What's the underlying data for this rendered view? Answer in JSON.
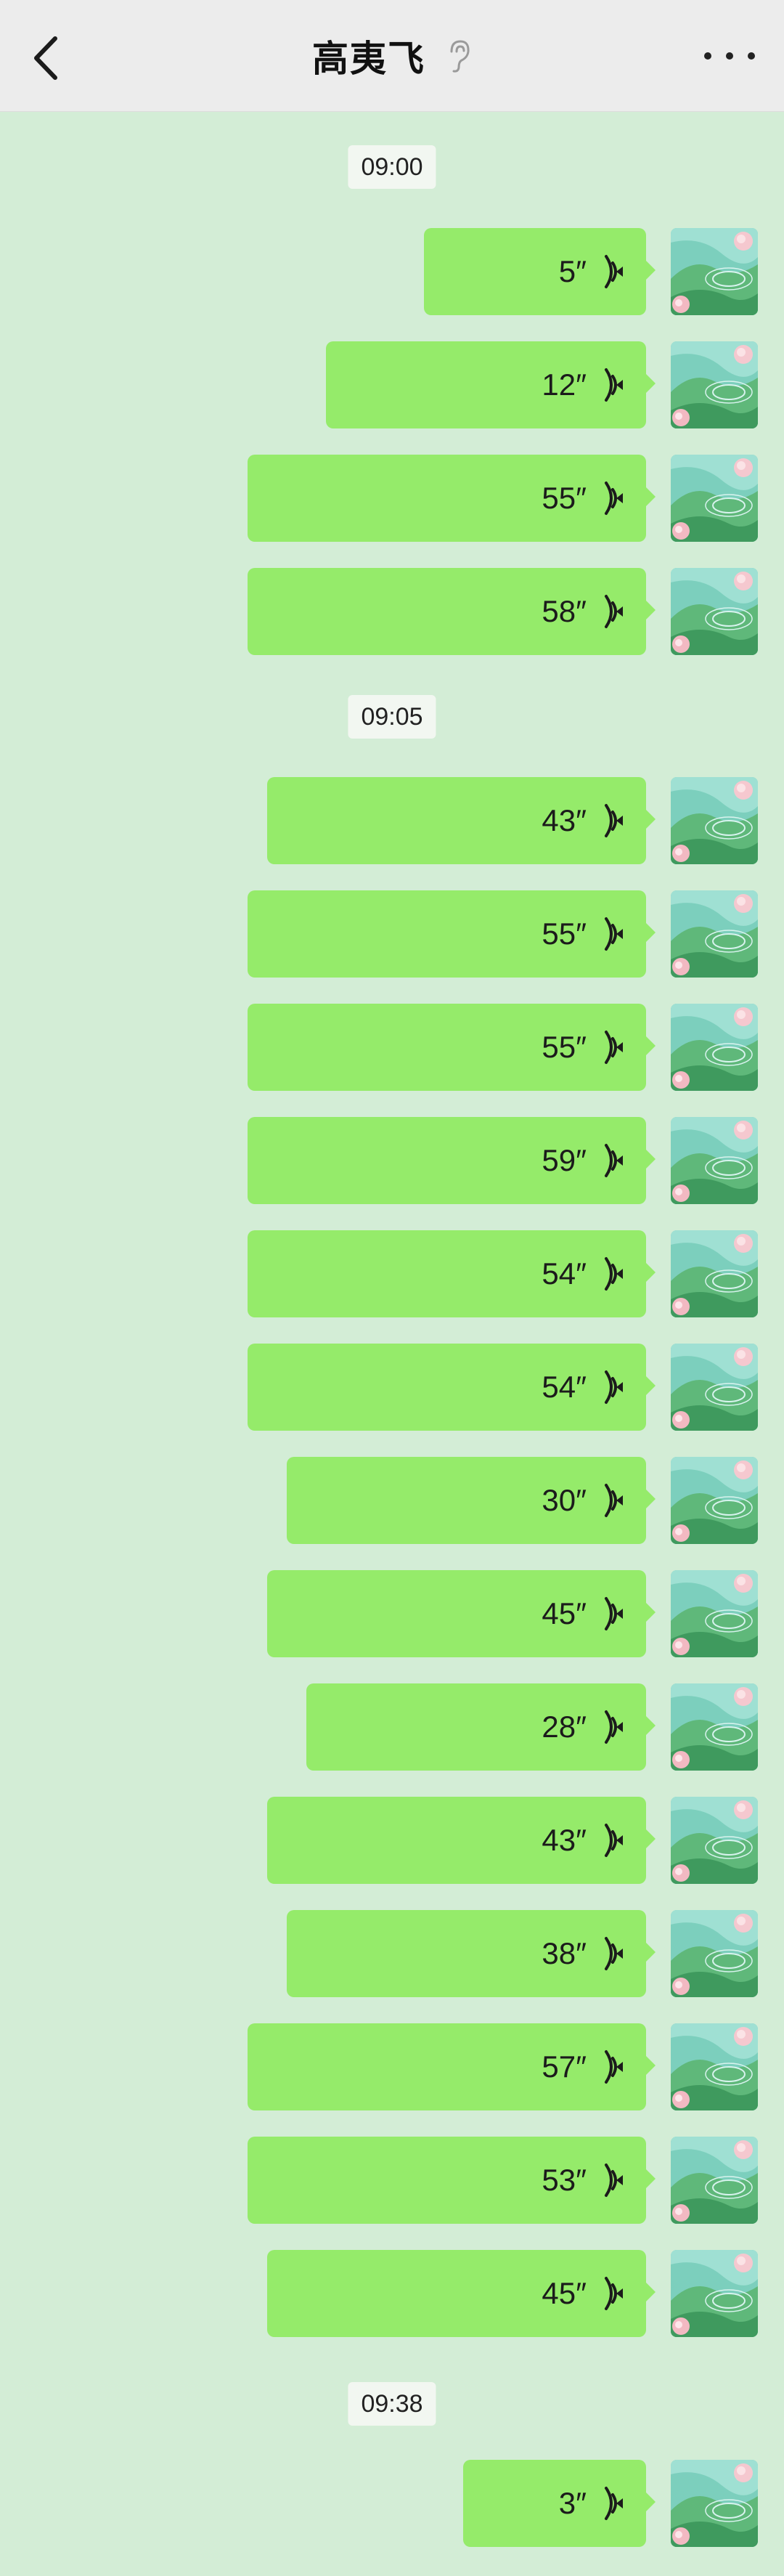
{
  "header": {
    "title": "高夷飞",
    "back_icon": "chevron-left-icon",
    "earpiece_icon": "ear-icon",
    "more_icon": "more-dots-icon"
  },
  "colors": {
    "background": "#d3edd6",
    "bubble": "#95eb6a",
    "header": "#ececec"
  },
  "timestamps": [
    "09:00",
    "09:05",
    "09:38"
  ],
  "messages": [
    {
      "duration": "5″"
    },
    {
      "duration": "12″"
    },
    {
      "duration": "55″"
    },
    {
      "duration": "58″"
    },
    {
      "duration": "43″"
    },
    {
      "duration": "55″"
    },
    {
      "duration": "55″"
    },
    {
      "duration": "59″"
    },
    {
      "duration": "54″"
    },
    {
      "duration": "54″"
    },
    {
      "duration": "30″"
    },
    {
      "duration": "45″"
    },
    {
      "duration": "28″"
    },
    {
      "duration": "43″"
    },
    {
      "duration": "38″"
    },
    {
      "duration": "57″"
    },
    {
      "duration": "53″"
    },
    {
      "duration": "45″"
    },
    {
      "duration": "3″"
    }
  ]
}
